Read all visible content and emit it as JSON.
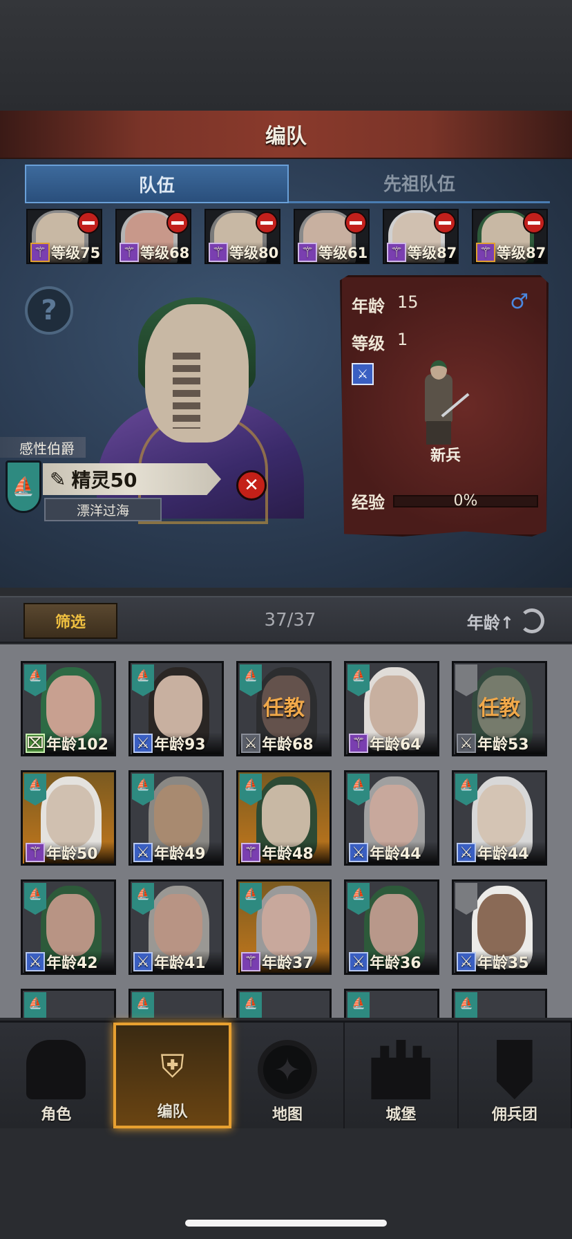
{
  "header": {
    "title": "编队"
  },
  "tabs": [
    {
      "label": "队伍",
      "active": true
    },
    {
      "label": "先祖队伍",
      "active": false
    }
  ],
  "team_members": [
    {
      "level_label": "等级75",
      "hair": "#8a8a8a",
      "skin": "#c8b8a4",
      "class_icon": "staff-icon",
      "star": true
    },
    {
      "level_label": "等级68",
      "hair": "#b4b4b4",
      "skin": "#c8988a",
      "class_icon": "staff-icon",
      "star": false
    },
    {
      "level_label": "等级80",
      "hair": "#7a7a7a",
      "skin": "#c8b8a4",
      "class_icon": "staff-icon",
      "star": false
    },
    {
      "level_label": "等级61",
      "hair": "#8a8a8a",
      "skin": "#c8b0a0",
      "class_icon": "staff-icon",
      "star": false
    },
    {
      "level_label": "等级87",
      "hair": "#d0d0d0",
      "skin": "#d0c0b0",
      "class_icon": "staff-icon",
      "star": false
    },
    {
      "level_label": "等级87",
      "hair": "#2d5a3a",
      "skin": "#c8b8a4",
      "class_icon": "staff-icon",
      "star": true
    }
  ],
  "selected": {
    "title": "感性伯爵",
    "name": "精灵50",
    "trait": "漂洋过海",
    "age_label": "年龄",
    "age": "15",
    "level_label": "等级",
    "level": "1",
    "unit_class": "新兵",
    "exp_label": "经验",
    "exp_value": "0%",
    "exp_fraction": 0
  },
  "filter": {
    "button_label": "筛选",
    "count": "37/37",
    "sort_label": "年龄↑"
  },
  "roster": [
    {
      "label": "年龄102",
      "hair": "#2d6a44",
      "skin": "#c8a090",
      "badge": "green",
      "teaching": "",
      "gold": false,
      "banner": true
    },
    {
      "label": "年龄93",
      "hair": "#2a2624",
      "skin": "#c8b0a0",
      "badge": "blue",
      "teaching": "",
      "gold": false,
      "banner": true
    },
    {
      "label": "年龄68",
      "hair": "#1c1a18",
      "skin": "#a88070",
      "badge": "blue",
      "teaching": "任教",
      "gold": false,
      "banner": true
    },
    {
      "label": "年龄64",
      "hair": "#e0dcd8",
      "skin": "#c8b0a0",
      "badge": "purple",
      "teaching": "",
      "gold": false,
      "banner": true
    },
    {
      "label": "年龄53",
      "hair": "#2d5a3a",
      "skin": "#c8b8a4",
      "badge": "blue",
      "teaching": "任教",
      "gold": false,
      "banner": false
    },
    {
      "label": "年龄50",
      "hair": "#e4e2de",
      "skin": "#d0c0b0",
      "badge": "purple",
      "teaching": "",
      "gold": true,
      "banner": true
    },
    {
      "label": "年龄49",
      "hair": "#8a8884",
      "skin": "#a88a70",
      "badge": "blue",
      "teaching": "",
      "gold": false,
      "banner": true
    },
    {
      "label": "年龄48",
      "hair": "#2d4a34",
      "skin": "#c8b8a4",
      "badge": "purple",
      "teaching": "",
      "gold": true,
      "banner": true
    },
    {
      "label": "年龄44",
      "hair": "#a0a0a0",
      "skin": "#c8a89c",
      "badge": "blue",
      "teaching": "",
      "gold": false,
      "banner": true
    },
    {
      "label": "年龄44",
      "hair": "#d8d8d8",
      "skin": "#d4c4b4",
      "badge": "blue",
      "teaching": "",
      "gold": false,
      "banner": true
    },
    {
      "label": "年龄42",
      "hair": "#2d5a3a",
      "skin": "#b89484",
      "badge": "blue",
      "teaching": "",
      "gold": false,
      "banner": true
    },
    {
      "label": "年龄41",
      "hair": "#9a9894",
      "skin": "#b89484",
      "badge": "blue",
      "teaching": "",
      "gold": false,
      "banner": true
    },
    {
      "label": "年龄37",
      "hair": "#9a9a9a",
      "skin": "#c8a89c",
      "badge": "purple",
      "teaching": "",
      "gold": true,
      "banner": true
    },
    {
      "label": "年龄36",
      "hair": "#2d5a3a",
      "skin": "#b8988a",
      "badge": "blue",
      "teaching": "",
      "gold": false,
      "banner": true
    },
    {
      "label": "年龄35",
      "hair": "#ecebe8",
      "skin": "#8a6a56",
      "badge": "blue",
      "teaching": "",
      "gold": false,
      "banner": false
    }
  ],
  "nav": [
    {
      "label": "角色",
      "icon": "knight-icon"
    },
    {
      "label": "编队",
      "icon": "helmet-icon",
      "active": true
    },
    {
      "label": "地图",
      "icon": "compass-icon"
    },
    {
      "label": "城堡",
      "icon": "castle-icon"
    },
    {
      "label": "佣兵团",
      "icon": "mercenary-banner-icon"
    }
  ]
}
